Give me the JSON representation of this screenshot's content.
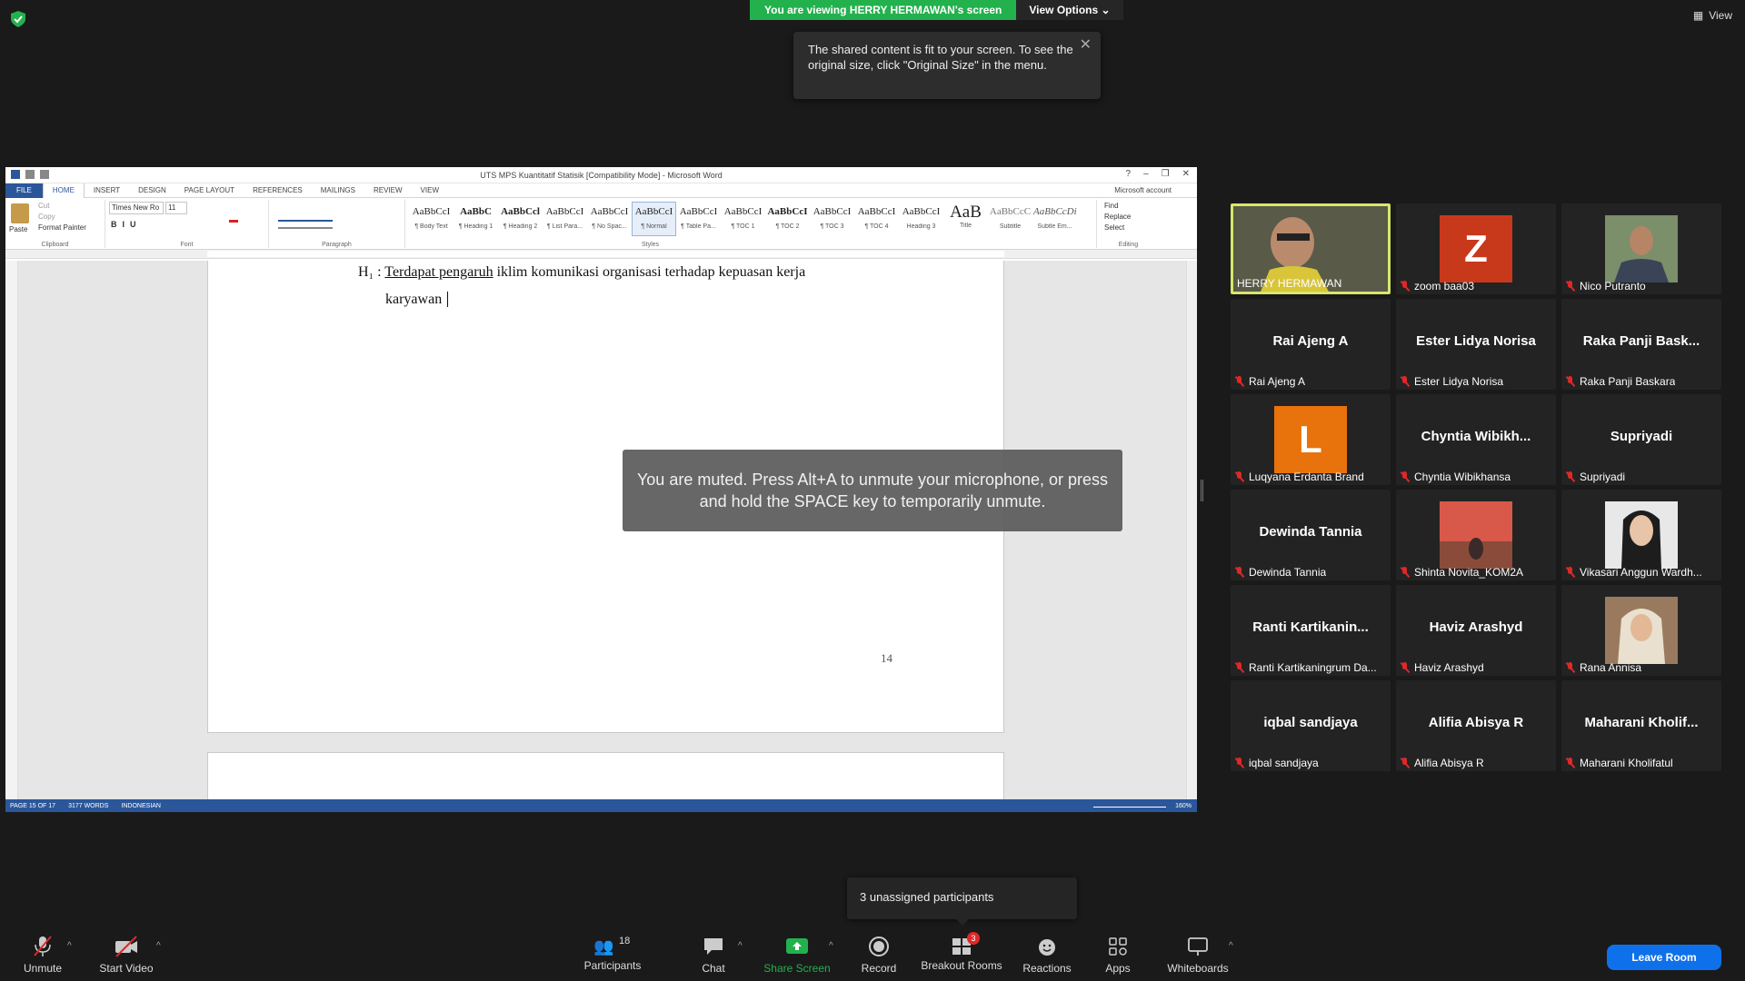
{
  "banner": {
    "viewing": "You are viewing HERRY HERMAWAN's screen",
    "view_options": "View Options"
  },
  "view_button": "View",
  "tooltip": "The shared content is fit to your screen. To see the original size, click \"Original Size\" in the menu.",
  "word": {
    "title": "UTS MPS Kuantitatif Statisik [Compatibility Mode] - Microsoft Word",
    "account": "Microsoft account",
    "tabs": [
      "FILE",
      "HOME",
      "INSERT",
      "DESIGN",
      "PAGE LAYOUT",
      "REFERENCES",
      "MAILINGS",
      "REVIEW",
      "VIEW"
    ],
    "clipboard": {
      "paste": "Paste",
      "cut": "Cut",
      "copy": "Copy",
      "format_painter": "Format Painter",
      "group": "Clipboard"
    },
    "font": {
      "name": "Times New Ro",
      "size": "11",
      "group": "Font"
    },
    "paragraph_group": "Paragraph",
    "styles_group": "Styles",
    "styles": [
      {
        "preview": "AaBbCcI",
        "name": "¶ Body Text"
      },
      {
        "preview": "AaBbC",
        "name": "¶ Heading 1"
      },
      {
        "preview": "AaBbCcl",
        "name": "¶ Heading 2"
      },
      {
        "preview": "AaBbCcI",
        "name": "¶ List Para..."
      },
      {
        "preview": "AaBbCcI",
        "name": "¶ No Spac..."
      },
      {
        "preview": "AaBbCcI",
        "name": "¶ Normal"
      },
      {
        "preview": "AaBbCcI",
        "name": "¶ Table Pa..."
      },
      {
        "preview": "AaBbCcI",
        "name": "¶ TOC 1"
      },
      {
        "preview": "AaBbCcI",
        "name": "¶ TOC 2"
      },
      {
        "preview": "AaBbCcI",
        "name": "¶ TOC 3"
      },
      {
        "preview": "AaBbCcI",
        "name": "¶ TOC 4"
      },
      {
        "preview": "AaBbCcI",
        "name": "Heading 3"
      },
      {
        "preview": "AaB",
        "name": "Title"
      },
      {
        "preview": "AaBbCcC",
        "name": "Subtitle"
      },
      {
        "preview": "AaBbCcDi",
        "name": "Subtle Em..."
      }
    ],
    "editing": {
      "find": "Find",
      "replace": "Replace",
      "select": "Select",
      "group": "Editing"
    },
    "doc": {
      "line1_prefix": "H₁ : ",
      "line1_underlined": "Terdapat pengaruh",
      "line1_rest": " iklim komunikasi organisasi terhadap kepuasan kerja",
      "line2": "karyawan",
      "page_number": "14"
    },
    "status": {
      "page": "PAGE 15 OF 17",
      "words": "3177 WORDS",
      "language": "INDONESIAN",
      "zoom": "160%"
    }
  },
  "muted_toast": "You are muted. Press Alt+A to unmute your microphone, or press and hold the SPACE key to temporarily unmute.",
  "participants": [
    {
      "big": "",
      "label": "HERRY HERMAWAN",
      "type": "video"
    },
    {
      "big": "Z",
      "label": "zoom baa03",
      "type": "letter",
      "color": "#c8391c"
    },
    {
      "big": "",
      "label": "Nico Putranto",
      "type": "photo"
    },
    {
      "big": "Rai Ajeng A",
      "label": "Rai Ajeng A",
      "type": "name"
    },
    {
      "big": "Ester Lidya Norisa",
      "label": "Ester Lidya Norisa",
      "type": "name"
    },
    {
      "big": "Raka Panji Bask...",
      "label": "Raka Panji Baskara",
      "type": "name"
    },
    {
      "big": "L",
      "label": "Luqyana Erdanta Brand",
      "type": "letter",
      "color": "#e8720c"
    },
    {
      "big": "Chyntia Wibikh...",
      "label": "Chyntia Wibikhansa",
      "type": "name"
    },
    {
      "big": "Supriyadi",
      "label": "Supriyadi",
      "type": "name"
    },
    {
      "big": "Dewinda Tannia",
      "label": "Dewinda Tannia",
      "type": "name"
    },
    {
      "big": "",
      "label": "Shinta Novita_KOM2A",
      "type": "photo"
    },
    {
      "big": "",
      "label": "Vikasari Anggun Wardh...",
      "type": "photo"
    },
    {
      "big": "Ranti Kartikanin...",
      "label": "Ranti Kartikaningrum Da...",
      "type": "name"
    },
    {
      "big": "Haviz Arashyd",
      "label": "Haviz Arashyd",
      "type": "name"
    },
    {
      "big": "",
      "label": "Rana Annisa",
      "type": "photo"
    },
    {
      "big": "iqbal sandjaya",
      "label": "iqbal sandjaya",
      "type": "name"
    },
    {
      "big": "Alifia Abisya R",
      "label": "Alifia Abisya R",
      "type": "name"
    },
    {
      "big": "Maharani Kholif...",
      "label": "Maharani Kholifatul",
      "type": "name"
    }
  ],
  "unassigned": "3 unassigned participants",
  "toolbar": {
    "unmute": "Unmute",
    "start_video": "Start Video",
    "participants": "Participants",
    "participants_count": "18",
    "chat": "Chat",
    "share_screen": "Share Screen",
    "record": "Record",
    "breakout_rooms": "Breakout Rooms",
    "breakout_badge": "3",
    "reactions": "Reactions",
    "apps": "Apps",
    "whiteboards": "Whiteboards",
    "leave": "Leave Room"
  },
  "colors": {
    "zoom_green": "#23b14d",
    "word_blue": "#2b579a",
    "leave_blue": "#0e71eb",
    "active_speaker": "#d6e76b",
    "muted_red": "#e02828"
  }
}
